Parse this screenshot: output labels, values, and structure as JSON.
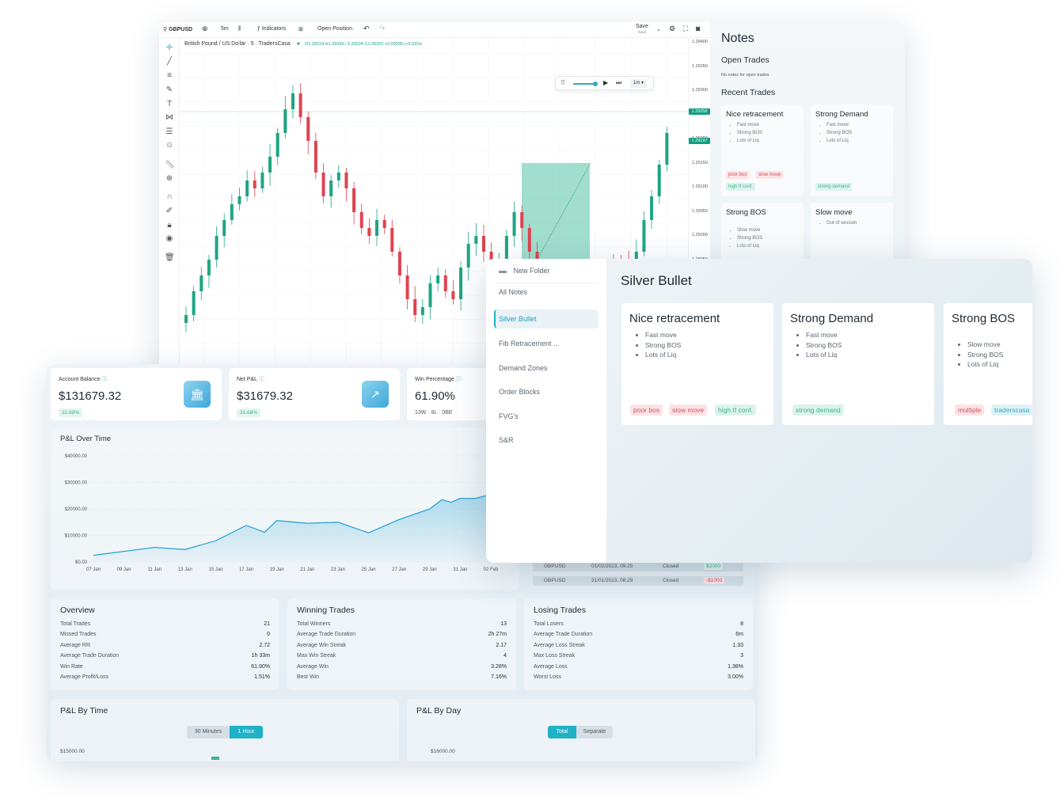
{
  "chart_panel": {
    "toolbar": {
      "symbol": "GBPUSD",
      "interval": "5m",
      "indicators_label": "Indicators",
      "open_position_label": "Open Position",
      "save_label": "Save",
      "save_sub_label": "Save"
    },
    "legend": {
      "title": "British Pound / US Dollar · 5 · TradersCasa",
      "ohlc": "O1.29224 H1.29266 L1.29224 C1.29258 +0.00035 (+0.03%)"
    },
    "replay": {
      "speed": "1m"
    },
    "price_scale": [
      "1.29400",
      "1.29350",
      "1.29300",
      "1.29250",
      "1.29200",
      "1.29150",
      "1.29100",
      "1.29050",
      "1.29000",
      "1.28950"
    ],
    "price_tags": [
      "1.29258",
      "1.29197"
    ],
    "notes_sidebar": {
      "title": "Notes",
      "open_trades_heading": "Open Trades",
      "open_trades_empty": "No notes for open trades",
      "recent_trades_heading": "Recent Trades",
      "cards": [
        {
          "title": "Nice retracement",
          "bullets": [
            "Fast move",
            "Strong BOS",
            "Lots of Liq"
          ],
          "tags": [
            {
              "text": "poor bos",
              "color": "red"
            },
            {
              "text": "slow move",
              "color": "red"
            },
            {
              "text": "high tf conf.",
              "color": "green"
            }
          ]
        },
        {
          "title": "Strong Demand",
          "bullets": [
            "Fast move",
            "Strong BOS",
            "Lots of Liq"
          ],
          "tags": [
            {
              "text": "strong demand",
              "color": "green"
            }
          ]
        },
        {
          "title": "Strong BOS",
          "bullets": [
            "Slow move",
            "Strong BOS",
            "Lots of Liq"
          ],
          "tags": []
        },
        {
          "title": "Slow move",
          "bullets": [
            "Out of session"
          ],
          "tags": []
        }
      ]
    }
  },
  "dashboard": {
    "stats": [
      {
        "label": "Account Balance",
        "value": "$131679.32",
        "pill": "31.68%",
        "icon": "bank-icon"
      },
      {
        "label": "Net P&L",
        "value": "$31679.32",
        "pill": "31.68%",
        "icon": "trend-up-icon"
      },
      {
        "label": "Win Percentage",
        "value": "61.90%",
        "sub": "13W · 8L · 0BE"
      }
    ],
    "pnl_chart_title": "P&L Over Time",
    "recent_trades": [
      {
        "symbol": "GBPUSD",
        "date": "01/02/2023, 09:25",
        "status": "Closed",
        "pnl": "$2000",
        "color": "green"
      },
      {
        "symbol": "GBPUSD",
        "date": "31/01/2023, 08:29",
        "status": "Closed",
        "pnl": "-$1000",
        "color": "red"
      }
    ],
    "overview": {
      "title": "Overview",
      "rows": [
        {
          "k": "Total Trades",
          "v": "21"
        },
        {
          "k": "Missed Trades",
          "v": "0"
        },
        {
          "k": "Average RR",
          "v": "2.72"
        },
        {
          "k": "Average Trade Duration",
          "v": "1h 33m"
        },
        {
          "k": "Win Rate",
          "v": "61.90%"
        },
        {
          "k": "Average Profit/Loss",
          "v": "1.51%"
        }
      ]
    },
    "winning": {
      "title": "Winning Trades",
      "rows": [
        {
          "k": "Total Winners",
          "v": "13"
        },
        {
          "k": "Average Trade Duration",
          "v": "2h 27m"
        },
        {
          "k": "Average Win Streak",
          "v": "2.17"
        },
        {
          "k": "Max Win Streak",
          "v": "4"
        },
        {
          "k": "Average Win",
          "v": "3.28%"
        },
        {
          "k": "Best Win",
          "v": "7.16%"
        }
      ]
    },
    "losing": {
      "title": "Losing Trades",
      "rows": [
        {
          "k": "Total Losers",
          "v": "8"
        },
        {
          "k": "Average Trade Duration",
          "v": "6m"
        },
        {
          "k": "Average Loss Streak",
          "v": "1.33"
        },
        {
          "k": "Max Loss Streak",
          "v": "3"
        },
        {
          "k": "Average Loss",
          "v": "1.38%"
        },
        {
          "k": "Worst Loss",
          "v": "3.00%"
        }
      ]
    },
    "pnl_by_time": {
      "title": "P&L By Time",
      "opt1": "30 Minutes",
      "opt2": "1 Hour",
      "ytop": "$15000.00"
    },
    "pnl_by_day": {
      "title": "P&L By Day",
      "opt1": "Total",
      "opt2": "Separate",
      "ytop": "$16000.00"
    }
  },
  "chart_data": {
    "type": "area",
    "title": "P&L Over Time",
    "categories": [
      "07 Jan",
      "09 Jan",
      "11 Jan",
      "13 Jan",
      "15 Jan",
      "17 Jan",
      "19 Jan",
      "21 Jan",
      "23 Jan",
      "25 Jan",
      "27 Jan",
      "29 Jan",
      "31 Jan",
      "02 Feb"
    ],
    "x": [
      0,
      1,
      2,
      3,
      4,
      5,
      5.6,
      6,
      7,
      8,
      9,
      10,
      11,
      11.4,
      11.7,
      12,
      12.5,
      13
    ],
    "y": [
      2500,
      4000,
      5500,
      4700,
      8000,
      13800,
      11200,
      15600,
      14600,
      15000,
      11000,
      16000,
      20000,
      23500,
      22500,
      24000,
      24000,
      25500
    ],
    "ylim": [
      0,
      40000
    ],
    "yticks": [
      "$40000.00",
      "$30000.00",
      "$20000.00",
      "$10000.00",
      "$0.00"
    ],
    "color": "#2aa6d6"
  },
  "notes_window": {
    "new_folder_label": "New Folder",
    "folders": [
      "All Notes",
      "Silver Bullet",
      "Fib Retracement ...",
      "Demand Zones",
      "Order Blocks",
      "FVG's",
      "S&R"
    ],
    "active_folder": "Silver Bullet",
    "heading": "Silver Bullet",
    "cards": [
      {
        "title": "Nice retracement",
        "bullets": [
          "Fast move",
          "Strong BOS",
          "Lots of Liq"
        ],
        "tags": [
          {
            "text": "poor bos",
            "color": "red"
          },
          {
            "text": "slow move",
            "color": "red"
          },
          {
            "text": "high tf conf.",
            "color": "green"
          }
        ]
      },
      {
        "title": "Strong Demand",
        "bullets": [
          "Fast move",
          "Strong BOS",
          "Lots of Liq"
        ],
        "tags": [
          {
            "text": "strong demand",
            "color": "green"
          }
        ]
      },
      {
        "title": "Strong BOS",
        "bullets": [
          "Slow move",
          "Strong BOS",
          "Lots of Liq"
        ],
        "tags": [
          {
            "text": "multiple",
            "color": "red"
          },
          {
            "text": "traderscasa",
            "color": "teal"
          }
        ]
      }
    ]
  }
}
